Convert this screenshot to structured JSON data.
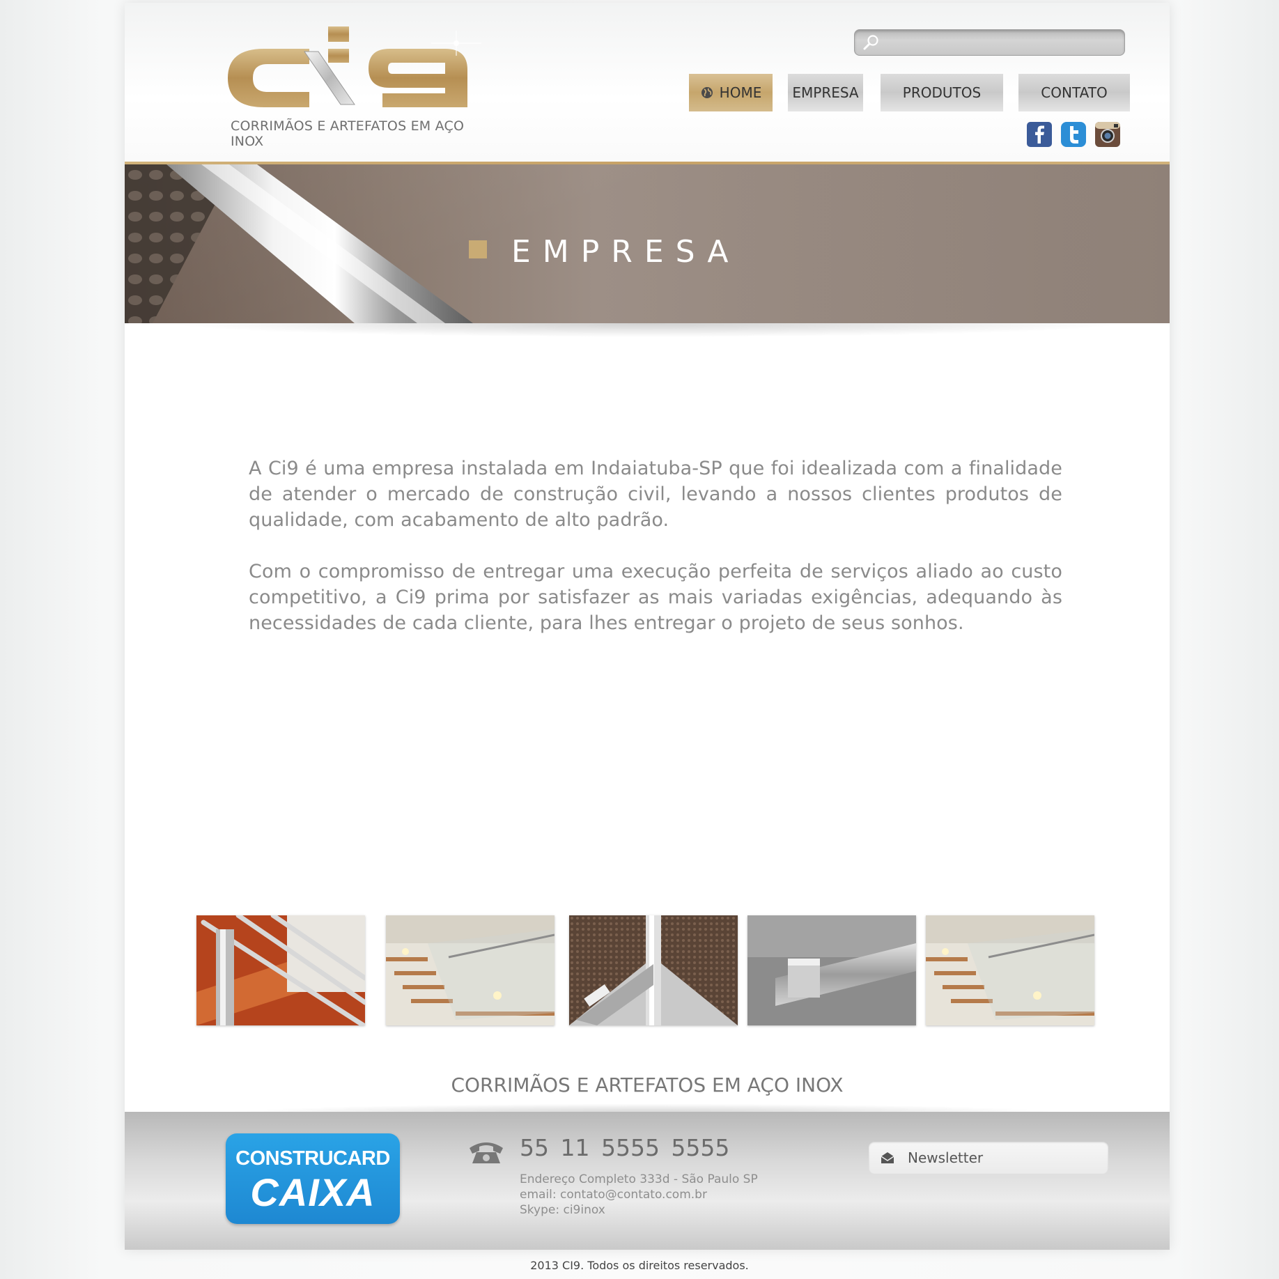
{
  "header": {
    "logo_text": "ci9",
    "tagline": "CORRIMÃOS E ARTEFATOS EM AÇO INOX",
    "search": {
      "placeholder": ""
    }
  },
  "nav": {
    "items": [
      {
        "label": "HOME",
        "active": true
      },
      {
        "label": "EMPRESA",
        "active": false
      },
      {
        "label": "PRODUTOS",
        "active": false
      },
      {
        "label": "CONTATO",
        "active": false
      }
    ]
  },
  "social": [
    "facebook-icon",
    "twitter-icon",
    "instagram-icon"
  ],
  "banner": {
    "title": "EMPRESA"
  },
  "content": {
    "paragraphs": [
      "A Ci9 é uma empresa instalada em Indaiatuba-SP que foi idealizada com a finalidade de atender o mercado de construção civil, levando a nossos clientes produtos de qualidade, com acabamento de alto padrão.",
      "Com o compromisso de entregar uma execução perfeita de serviços aliado ao custo competitivo, a Ci9 prima por satisfazer as mais variadas exigências, adequando às necessidades de cada cliente, para lhes entregar o projeto de seus sonhos."
    ]
  },
  "gallery": {
    "images": [
      "railing-wood-stairs",
      "glass-staircase",
      "stainless-corner-mesh",
      "square-handrail-bracket",
      "glass-staircase"
    ]
  },
  "bottom_tagline": "CORRIMÃOS E ARTEFATOS EM AÇO INOX",
  "footer": {
    "badge_top": "CONSTRUCARD",
    "badge_bottom": "CAIXA",
    "phone": "55  11  5555 5555",
    "address": "Endereço Completo 333d - São Paulo SP",
    "email": "email: contato@contato.com.br",
    "skype": "Skype: ci9inox",
    "newsletter_label": "Newsletter"
  },
  "copyright": "2013 CI9. Todos os direitos reservados.",
  "colors": {
    "gold": "#c6a66c",
    "text_gray": "#8a8a8a",
    "caixa_blue": "#1e88d2"
  }
}
